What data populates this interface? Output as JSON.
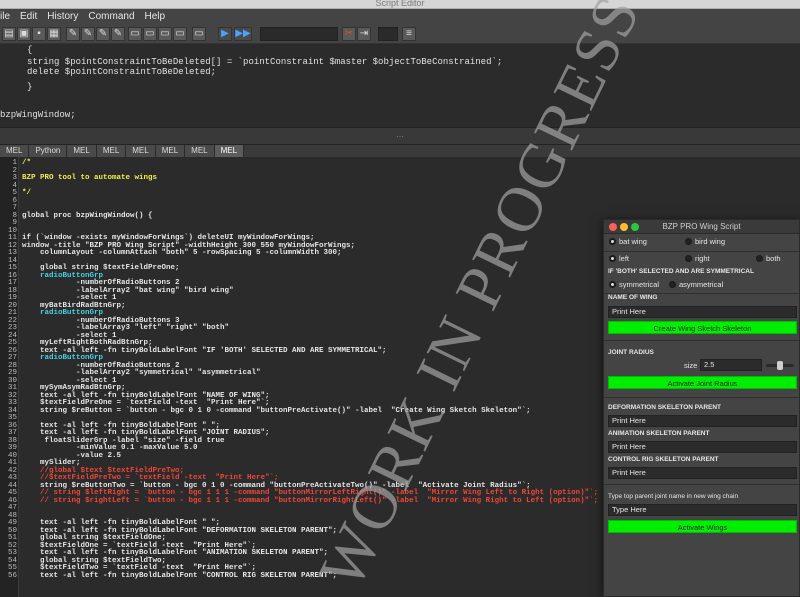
{
  "window": {
    "title": "Script Editor"
  },
  "menu": [
    "ile",
    "Edit",
    "History",
    "Command",
    "Help"
  ],
  "output_lines": [
    "     {",
    "     string $pointConstraintToBeDeleted[] = `pointConstraint $master $objectToBeConstrained`;",
    "     delete $pointConstraintToBeDeleted;",
    "     }",
    "",
    "",
    "bzpWingWindow;"
  ],
  "tabs": [
    "MEL",
    "Python",
    "MEL",
    "MEL",
    "MEL",
    "MEL",
    "MEL",
    "MEL"
  ],
  "active_tab_index": 7,
  "code_lines": [
    {
      "n": "1",
      "t": "/*",
      "c": "c-yellow"
    },
    {
      "n": "2",
      "t": "",
      "c": ""
    },
    {
      "n": "3",
      "t": "BZP PRO tool to automate wings",
      "c": "c-yellow"
    },
    {
      "n": "4",
      "t": "",
      "c": ""
    },
    {
      "n": "5",
      "t": "*/",
      "c": "c-yellow"
    },
    {
      "n": "6",
      "t": "",
      "c": ""
    },
    {
      "n": "7",
      "t": "",
      "c": ""
    },
    {
      "n": "8",
      "t": "global proc bzpWingWindow() {",
      "c": ""
    },
    {
      "n": "9",
      "t": "",
      "c": ""
    },
    {
      "n": "10",
      "t": "",
      "c": ""
    },
    {
      "n": "11",
      "t": "if (`window -exists myWindowForWings`) deleteUI myWindowForWings;",
      "c": ""
    },
    {
      "n": "12",
      "t": "window -title \"BZP PRO Wing Script\" -widthHeight 300 550 myWindowForWings;",
      "c": ""
    },
    {
      "n": "13",
      "t": "    columnLayout -columnAttach \"both\" 5 -rowSpacing 5 -columnWidth 300;",
      "c": ""
    },
    {
      "n": "14",
      "t": "",
      "c": ""
    },
    {
      "n": "15",
      "t": "    global string $textFieldPreOne;",
      "c": ""
    },
    {
      "n": "16",
      "t": "    radioButtonGrp",
      "c": "c-cyan"
    },
    {
      "n": "17",
      "t": "            -numberOfRadioButtons 2",
      "c": ""
    },
    {
      "n": "18",
      "t": "            -labelArray2 \"bat wing\" \"bird wing\"",
      "c": ""
    },
    {
      "n": "19",
      "t": "            -select 1",
      "c": ""
    },
    {
      "n": "20",
      "t": "    myBatBirdRadBtnGrp;",
      "c": ""
    },
    {
      "n": "21",
      "t": "    radioButtonGrp",
      "c": "c-cyan"
    },
    {
      "n": "22",
      "t": "            -numberOfRadioButtons 3",
      "c": ""
    },
    {
      "n": "23",
      "t": "            -labelArray3 \"left\" \"right\" \"both\"",
      "c": ""
    },
    {
      "n": "24",
      "t": "            -select 1",
      "c": ""
    },
    {
      "n": "25",
      "t": "    myLeftRightBothRadBtnGrp;",
      "c": ""
    },
    {
      "n": "26",
      "t": "    text -al left -fn tinyBoldLabelFont \"IF 'BOTH' SELECTED AND ARE SYMMETRICAL\";",
      "c": ""
    },
    {
      "n": "27",
      "t": "    radioButtonGrp",
      "c": "c-cyan"
    },
    {
      "n": "28",
      "t": "            -numberOfRadioButtons 2",
      "c": ""
    },
    {
      "n": "29",
      "t": "            -labelArray2 \"symmetrical\" \"asymmetrical\"",
      "c": ""
    },
    {
      "n": "30",
      "t": "            -select 1",
      "c": ""
    },
    {
      "n": "31",
      "t": "    mySymAsymRadBtnGrp;",
      "c": ""
    },
    {
      "n": "32",
      "t": "    text -al left -fn tinyBoldLabelFont \"NAME OF WING\";",
      "c": ""
    },
    {
      "n": "33",
      "t": "    $textFieldPreOne = `textField -text  \"Print Here\"`;",
      "c": ""
    },
    {
      "n": "34",
      "t": "    string $reButton = `button - bgc 0 1 0 -command \"buttonPreActivate()\" -label  \"Create Wing Sketch Skeleton\"`;",
      "c": ""
    },
    {
      "n": "35",
      "t": "",
      "c": ""
    },
    {
      "n": "36",
      "t": "    text -al left -fn tinyBoldLabelFont \" \";",
      "c": ""
    },
    {
      "n": "37",
      "t": "    text -al left -fn tinyBoldLabelFont \"JOINT RADIUS\";",
      "c": ""
    },
    {
      "n": "38",
      "t": "     floatSliderGrp -label \"size\" -field true",
      "c": ""
    },
    {
      "n": "39",
      "t": "            -minValue 0.1 -maxValue 5.0",
      "c": ""
    },
    {
      "n": "40",
      "t": "            -value 2.5",
      "c": ""
    },
    {
      "n": "41",
      "t": "    mySlider;",
      "c": ""
    },
    {
      "n": "42",
      "t": "    //global $text $textFieldPreTwo;",
      "c": "c-red"
    },
    {
      "n": "43",
      "t": "    //$textFieldPreTwo = `textField -text  \"Print Here\"`;",
      "c": "c-red"
    },
    {
      "n": "44",
      "t": "    string $reButtonTwo = `button - bgc 0 1 0 -command \"buttonPreActivateTwo()\" -label  \"Activate Joint Radius\"`;",
      "c": ""
    },
    {
      "n": "45",
      "t": "    // string $leftRight = `button - bgc 1 1 1 -command \"buttonMirrorLeftRight()\" -label  \"Mirror Wing Left to Right (option)\"`;",
      "c": "c-red"
    },
    {
      "n": "46",
      "t": "    // string $rightLeft = `button - bgc 1 1 1 -command \"buttonMirrorRightLeft()\" -label  \"Mirror Wing Right to Left (option)\"`;",
      "c": "c-red"
    },
    {
      "n": "47",
      "t": "",
      "c": ""
    },
    {
      "n": "48",
      "t": "",
      "c": ""
    },
    {
      "n": "49",
      "t": "    text -al left -fn tinyBoldLabelFont \" \";",
      "c": ""
    },
    {
      "n": "50",
      "t": "    text -al left -fn tinyBoldLabelFont \"DEFORMATION SKELETON PARENT\";",
      "c": ""
    },
    {
      "n": "51",
      "t": "    global string $textFieldOne;",
      "c": ""
    },
    {
      "n": "52",
      "t": "    $textFieldOne = `textField -text  \"Print Here\"`;",
      "c": ""
    },
    {
      "n": "53",
      "t": "    text -al left -fn tinyBoldLabelFont \"ANIMATION SKELETON PARENT\";",
      "c": ""
    },
    {
      "n": "54",
      "t": "    global string $textFieldTwo;",
      "c": ""
    },
    {
      "n": "55",
      "t": "    $textFieldTwo = `textField -text  \"Print Here\"`;",
      "c": ""
    },
    {
      "n": "56",
      "t": "    text -al left -fn tinyBoldLabelFont \"CONTROL RIG SKELETON PARENT\";",
      "c": ""
    }
  ],
  "watermark": "WORK IN PROGRESS",
  "dialog": {
    "title": "BZP PRO Wing Script",
    "radio_wing": [
      "bat wing",
      "bird wing"
    ],
    "radio_side": [
      "left",
      "right",
      "both"
    ],
    "sym_note": "IF 'BOTH' SELECTED AND ARE SYMMETRICAL",
    "radio_sym": [
      "symmetrical",
      "asymmetrical"
    ],
    "name_label": "NAME OF WING",
    "name_value": "Print Here",
    "create_button": "Create Wing Sketch Skeleton",
    "joint_label": "JOINT RADIUS",
    "size_label": "size",
    "size_value": "2.5",
    "size_fraction": 0.49,
    "activate_radius_button": "Activate Joint Radius",
    "deform_label": "DEFORMATION SKELETON PARENT",
    "deform_value": "Print Here",
    "anim_label": "ANIMATION SKELETON PARENT",
    "anim_value": "Print Here",
    "control_label": "CONTROL RIG SKELETON PARENT",
    "control_value": "Print Here",
    "chain_label": "Type top parent joint name in new wing chain",
    "chain_value": "Type Here",
    "activate_wings_button": "Activate Wings"
  }
}
